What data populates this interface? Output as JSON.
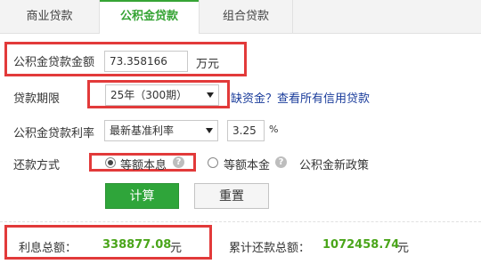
{
  "tabs": [
    {
      "label": "商业贷款"
    },
    {
      "label": "公积金贷款"
    },
    {
      "label": "组合贷款"
    }
  ],
  "form": {
    "amount_label": "公积金贷款金额",
    "amount_value": "73.358166",
    "amount_unit": "万元",
    "term_label": "贷款期限",
    "term_value": "25年（300期）",
    "term_link": "缺资金？查看所有信用贷款",
    "rate_label": "公积金贷款利率",
    "rate_type": "最新基准利率",
    "rate_value": "3.25",
    "rate_unit": "%",
    "method_label": "还款方式",
    "method_option1": "等额本息",
    "method_option2": "等额本金",
    "policy_link": "公积金新政策",
    "help_glyph": "?"
  },
  "buttons": {
    "calculate": "计算",
    "reset": "重置"
  },
  "results": {
    "interest_label": "利息总额：",
    "interest_value": "338877.08",
    "interest_unit": "元",
    "total_label": "累计还款总额：",
    "total_value": "1072458.74",
    "total_unit": "元"
  },
  "colors": {
    "accent_green": "#36a435",
    "highlight_red": "#e23a3a",
    "link_blue": "#1a3c9b"
  }
}
